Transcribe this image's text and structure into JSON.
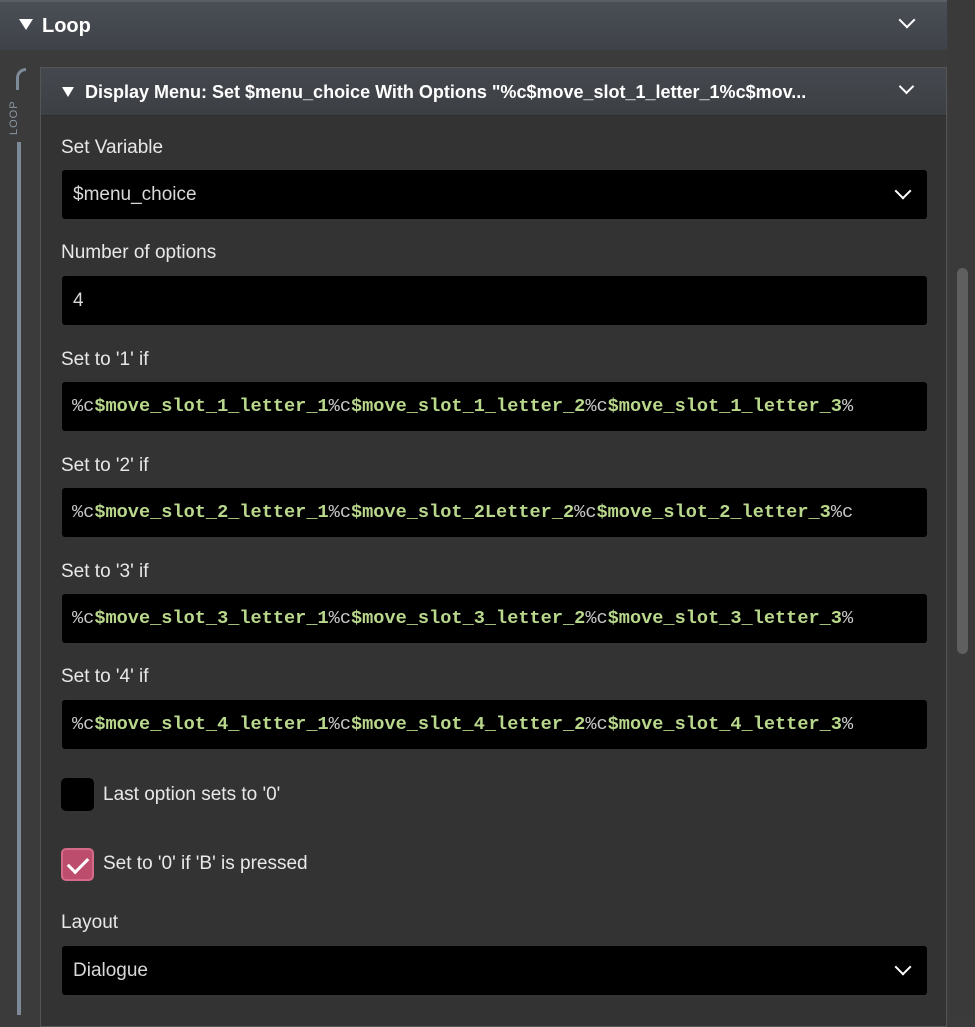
{
  "loop": {
    "title": "Loop",
    "rail_label": "LOOP"
  },
  "event": {
    "title": "Display Menu: Set $menu_choice With Options \"%c$move_slot_1_letter_1%c$mov...",
    "set_variable": {
      "label": "Set Variable",
      "value": "$menu_choice"
    },
    "number_of_options": {
      "label": "Number of options",
      "value": "4"
    },
    "options": [
      {
        "label": "Set to '1' if",
        "parts": [
          {
            "t": "%c",
            "k": "pct"
          },
          {
            "t": "$move_slot_1_letter_1",
            "k": "var"
          },
          {
            "t": "%c",
            "k": "pct"
          },
          {
            "t": "$move_slot_1_letter_2",
            "k": "var"
          },
          {
            "t": "%c",
            "k": "pct"
          },
          {
            "t": "$move_slot_1_letter_3",
            "k": "var"
          },
          {
            "t": "%",
            "k": "pct"
          }
        ]
      },
      {
        "label": "Set to '2' if",
        "parts": [
          {
            "t": "%c",
            "k": "pct"
          },
          {
            "t": "$move_slot_2_letter_1",
            "k": "var"
          },
          {
            "t": "%c",
            "k": "pct"
          },
          {
            "t": "$move_slot_2Letter_2",
            "k": "var"
          },
          {
            "t": "%c",
            "k": "pct"
          },
          {
            "t": "$move_slot_2_letter_3",
            "k": "var"
          },
          {
            "t": "%c",
            "k": "pct"
          }
        ]
      },
      {
        "label": "Set to '3' if",
        "parts": [
          {
            "t": "%c",
            "k": "pct"
          },
          {
            "t": "$move_slot_3_letter_1",
            "k": "var"
          },
          {
            "t": "%c",
            "k": "pct"
          },
          {
            "t": "$move_slot_3_letter_2",
            "k": "var"
          },
          {
            "t": "%c",
            "k": "pct"
          },
          {
            "t": "$move_slot_3_letter_3",
            "k": "var"
          },
          {
            "t": "%",
            "k": "pct"
          }
        ]
      },
      {
        "label": "Set to '4' if",
        "parts": [
          {
            "t": "%c",
            "k": "pct"
          },
          {
            "t": "$move_slot_4_letter_1",
            "k": "var"
          },
          {
            "t": "%c",
            "k": "pct"
          },
          {
            "t": "$move_slot_4_letter_2",
            "k": "var"
          },
          {
            "t": "%c",
            "k": "pct"
          },
          {
            "t": "$move_slot_4_letter_3",
            "k": "var"
          },
          {
            "t": "%",
            "k": "pct"
          }
        ]
      }
    ],
    "last_option_zero": {
      "label": "Last option sets to '0'",
      "checked": false
    },
    "b_pressed_zero": {
      "label": "Set to '0' if 'B' is pressed",
      "checked": true
    },
    "layout": {
      "label": "Layout",
      "value": "Dialogue"
    }
  },
  "colors": {
    "accent": "#bd4d6d",
    "variable": "#b9d88c"
  },
  "icons": [
    "triangle-down-icon",
    "chevron-down-icon",
    "checkmark-icon"
  ]
}
